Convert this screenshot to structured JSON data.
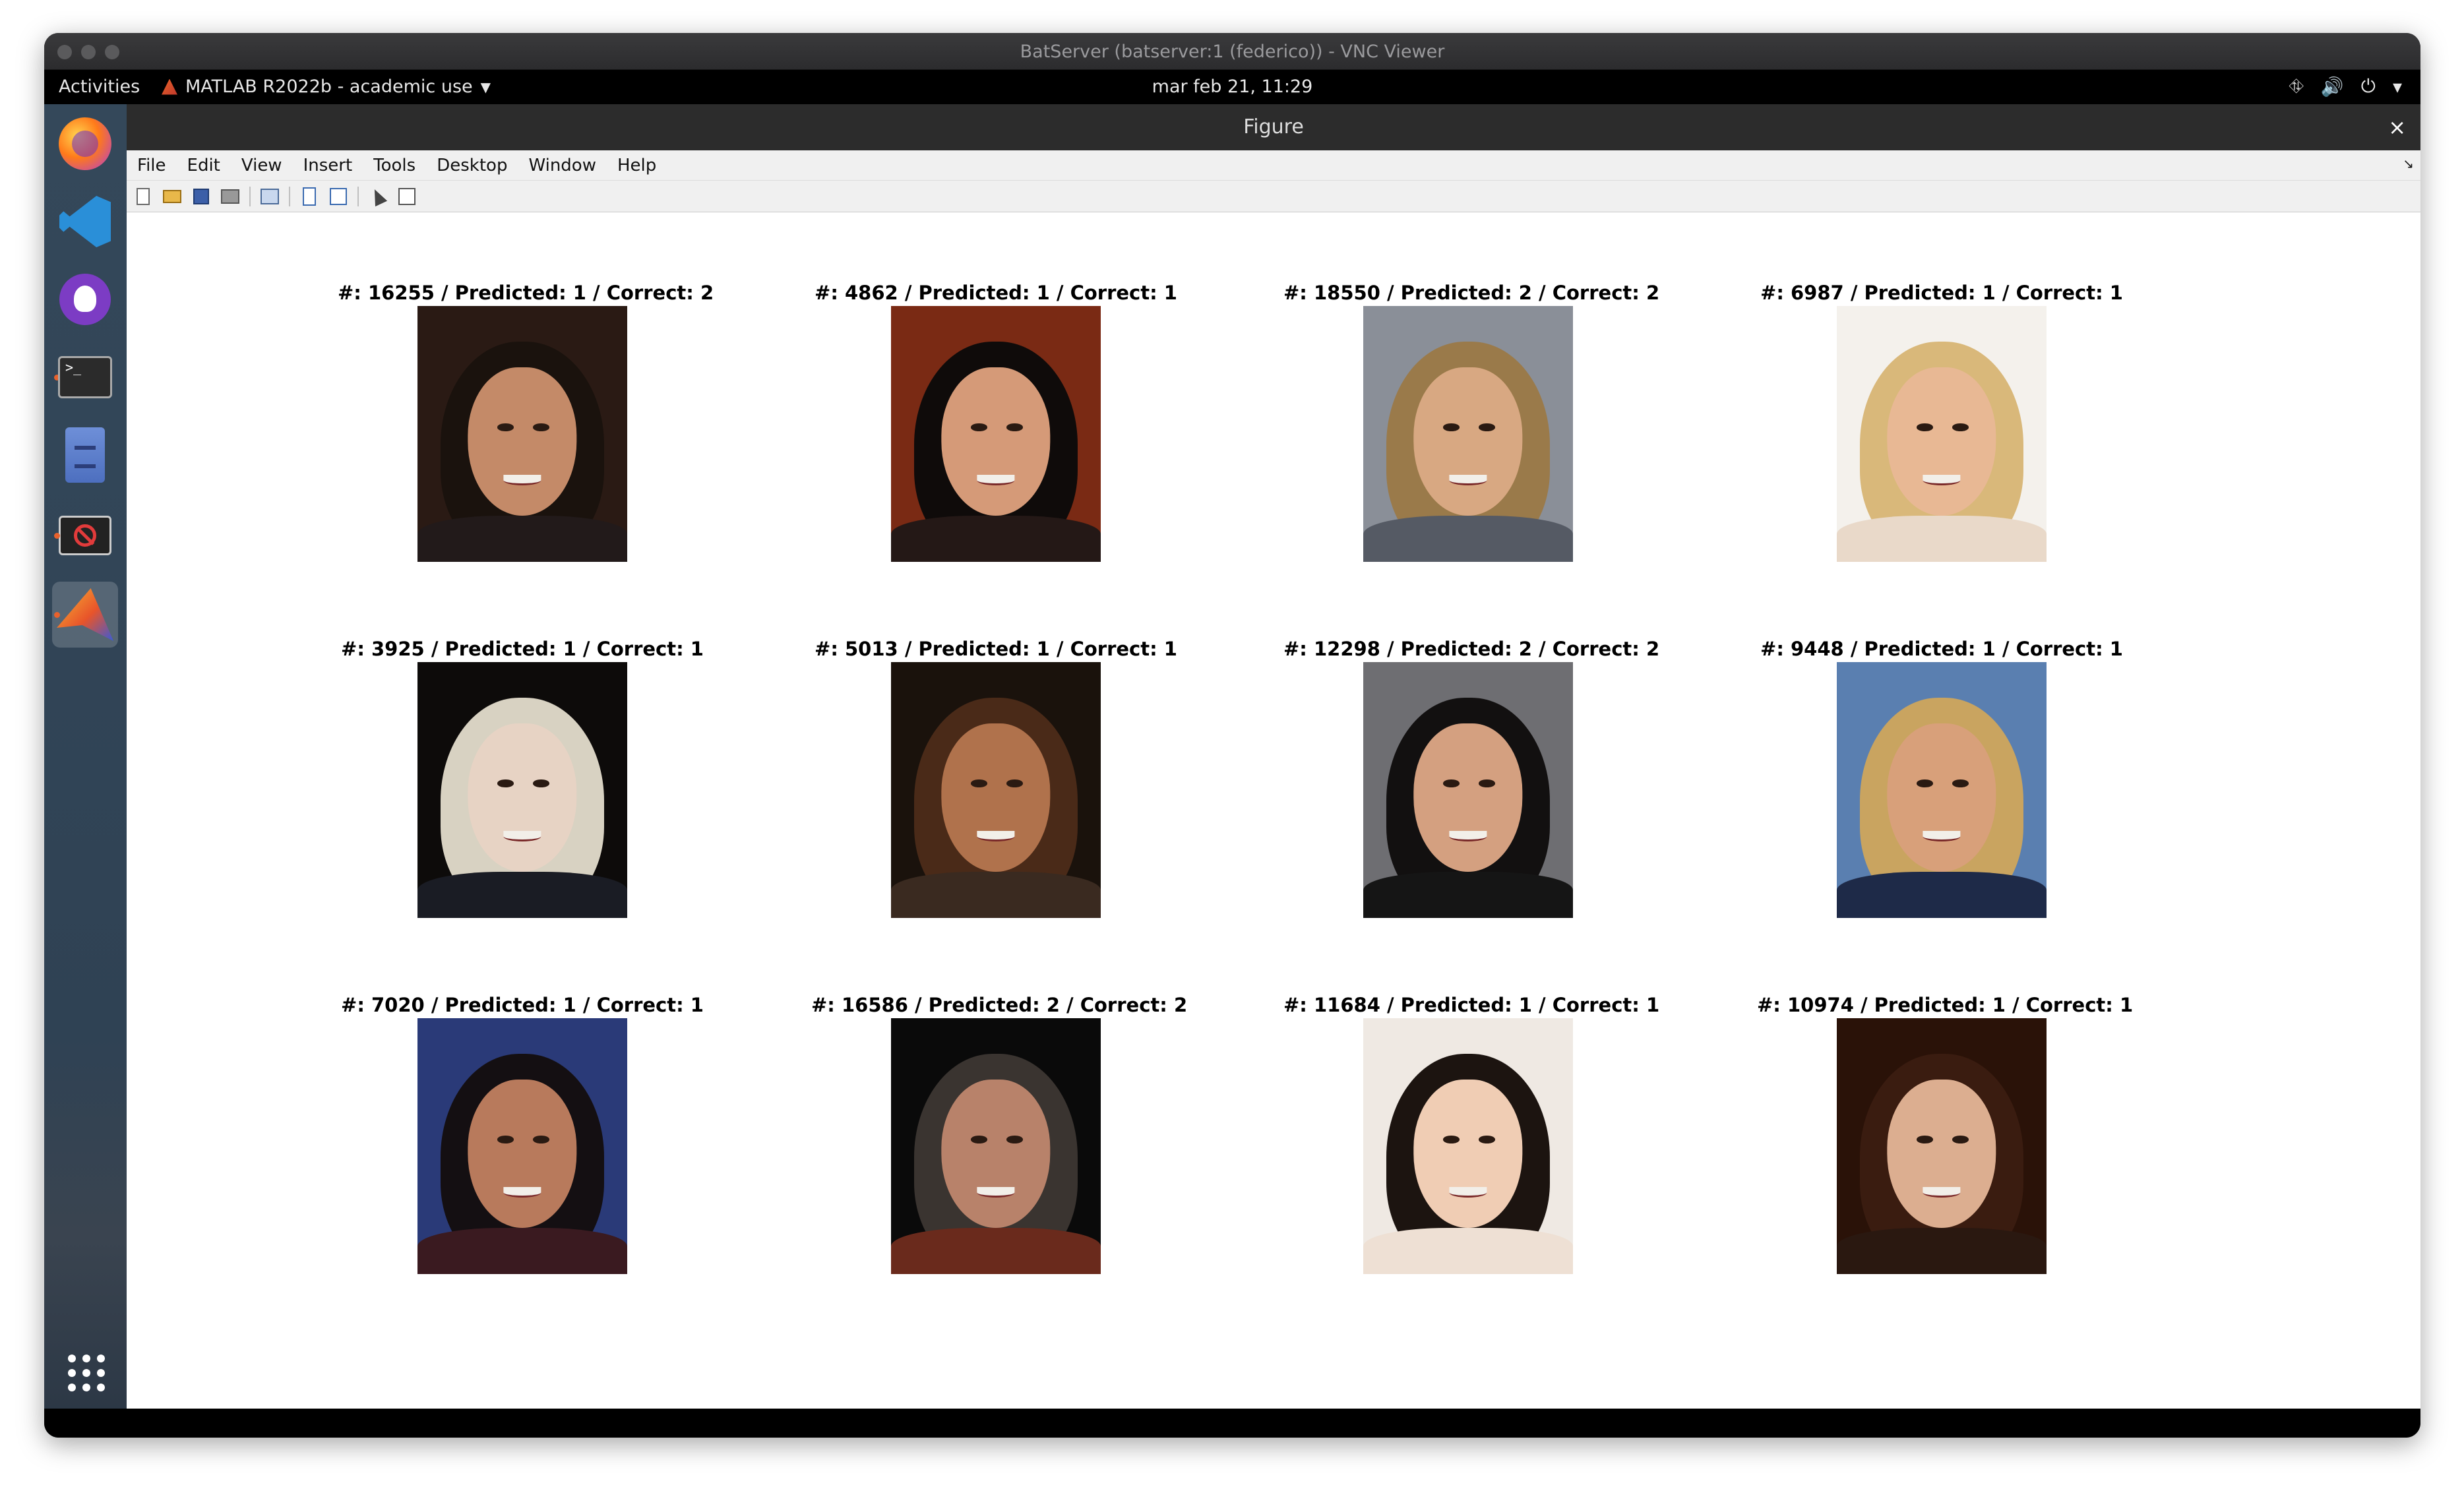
{
  "vnc": {
    "title": "BatServer (batserver:1 (federico)) - VNC Viewer"
  },
  "topbar": {
    "activities": "Activities",
    "app_menu": "MATLAB R2022b - academic use",
    "clock": "mar feb 21, 11:29",
    "tray_icons": [
      "network-icon",
      "volume-icon",
      "power-icon",
      "chevron-down-icon"
    ]
  },
  "dock": {
    "items": [
      {
        "name": "firefox",
        "icon": "firefox-icon",
        "running": false
      },
      {
        "name": "vscode",
        "icon": "vscode-icon",
        "running": false
      },
      {
        "name": "github-desktop",
        "icon": "github-icon",
        "running": false
      },
      {
        "name": "terminal",
        "icon": "terminal-icon",
        "running": true
      },
      {
        "name": "files",
        "icon": "file-cabinet-icon",
        "running": false
      },
      {
        "name": "blocked-app",
        "icon": "blocked-screen-icon",
        "running": true
      },
      {
        "name": "matlab",
        "icon": "matlab-icon",
        "running": true,
        "active": true
      }
    ],
    "show_apps_icon": "app-grid-icon"
  },
  "figure": {
    "title": "Figure",
    "close_glyph": "×",
    "menu": [
      "File",
      "Edit",
      "View",
      "Insert",
      "Tools",
      "Desktop",
      "Window",
      "Help"
    ],
    "toolbar": [
      "new-figure-icon",
      "open-file-icon",
      "save-icon",
      "print-icon",
      "link-plot-icon",
      "hide-toolbar-icon",
      "show-plot-tools-icon",
      "pointer-icon",
      "property-inspector-icon"
    ],
    "tiles": [
      {
        "title": "#: 16255 / Predicted: 1 / Correct: 2",
        "bg": "#2a1a14",
        "hair": "#1a120d",
        "skin": "#c48a68",
        "cloth": "#221a1a"
      },
      {
        "title": "#: 4862 / Predicted: 1 / Correct: 1",
        "bg": "#7a2a14",
        "hair": "#0f0b0a",
        "skin": "#d59a78",
        "cloth": "#241816"
      },
      {
        "title": "#: 18550 / Predicted: 2 / Correct: 2",
        "bg": "#8a8f98",
        "hair": "#9a7a4a",
        "skin": "#d8a882",
        "cloth": "#555a64"
      },
      {
        "title": "#: 6987 / Predicted: 1 / Correct: 1",
        "bg": "#f4f1ec",
        "hair": "#d9b87a",
        "skin": "#e8b894",
        "cloth": "#e9d9c9"
      },
      {
        "title": "#: 3925 / Predicted: 1 / Correct: 1",
        "bg": "#0d0b0a",
        "hair": "#d8d2c2",
        "skin": "#e7d3c4",
        "cloth": "#1a1c24"
      },
      {
        "title": "#: 5013 / Predicted: 1 / Correct: 1",
        "bg": "#1a120c",
        "hair": "#4a2a18",
        "skin": "#b0724c",
        "cloth": "#3a2a20"
      },
      {
        "title": "#: 12298 / Predicted: 2 / Correct: 2",
        "bg": "#6e6e72",
        "hair": "#121010",
        "skin": "#d4a080",
        "cloth": "#151515"
      },
      {
        "title": "#: 9448 / Predicted: 1 / Correct: 1",
        "bg": "#5a7fb0",
        "hair": "#c9a460",
        "skin": "#d8a07a",
        "cloth": "#1e2a48"
      },
      {
        "title": "#: 7020 / Predicted: 1 / Correct: 1",
        "bg": "#2a3a78",
        "hair": "#140f12",
        "skin": "#b87a5c",
        "cloth": "#3a1a20"
      },
      {
        "title": "#: 16586 / Predicted: 2 / Correct: 2",
        "bg": "#0a0a0a",
        "hair": "#3a3430",
        "skin": "#b8826a",
        "cloth": "#6a2a1c"
      },
      {
        "title": "#: 11684 / Predicted: 1 / Correct: 1",
        "bg": "#efe9e3",
        "hair": "#1c1410",
        "skin": "#f0cdb4",
        "cloth": "#eee0d4"
      },
      {
        "title": "#: 10974 / Predicted: 1 / Correct: 1",
        "bg": "#2a1208",
        "hair": "#3a1c10",
        "skin": "#dcae90",
        "cloth": "#2a1810"
      }
    ]
  }
}
